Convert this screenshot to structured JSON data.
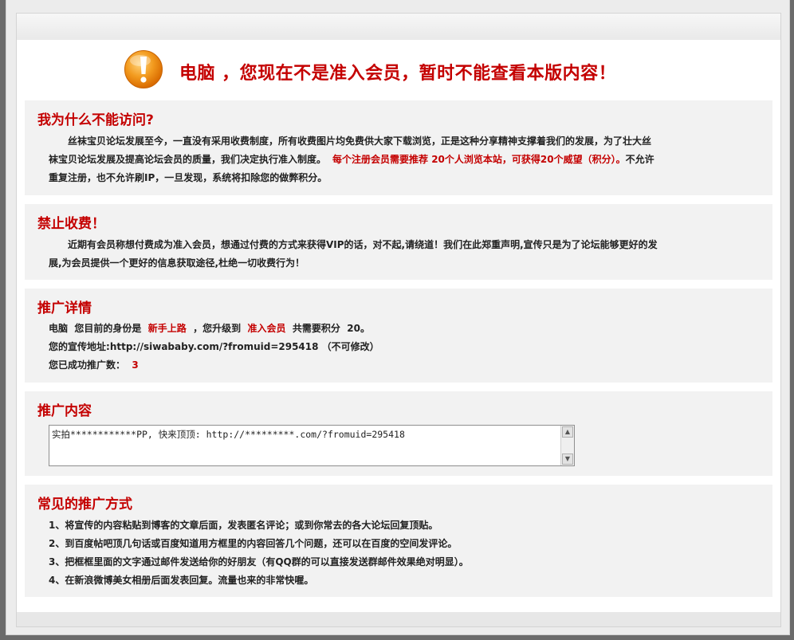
{
  "header": {
    "title": "电脑 ，您现在不是准入会员，暂时不能查看本版内容！"
  },
  "why": {
    "title": "我为什么不能访问?",
    "line1": "丝袜宝贝论坛发展至今，一直没有采用收费制度，所有收费图片均免费供大家下载浏览，正是这种分享精神支撑着我们的发展，为了壮大丝",
    "line2_pre": "袜宝贝论坛发展及提高论坛会员的质量，我们决定执行准入制度。",
    "line2_hl": "每个注册会员需要推荐 20个人浏览本站，可获得20个威望（积分）。",
    "line2_post": "不允许",
    "line3": "重复注册，也不允许刷IP，一旦发现，系统将扣除您的做弊积分。"
  },
  "nofee": {
    "title": "禁止收费！",
    "line1": "近期有会员称想付费成为准入会员，想通过付费的方式来获得VIP的话，对不起,请绕道！我们在此郑重声明,宣传只是为了论坛能够更好的发",
    "line2": "展,为会员提供一个更好的信息获取途径,杜绝一切收费行为！"
  },
  "promo": {
    "title": "推广详情",
    "user": "电脑",
    "identity_label": "您目前的身份是",
    "identity": "新手上路",
    "upgrade_label": "，您升级到",
    "target": "准入会员",
    "points_label": "共需要积分",
    "points": "20",
    "end": "。",
    "url_label": "您的宣传地址:",
    "url": "http://siwababy.com/?fromuid=295418",
    "url_note": "（不可修改）",
    "count_label": "您已成功推广数：",
    "count": "3"
  },
  "content": {
    "title": "推广内容",
    "text": "实拍************PP, 快来顶顶:  http://*********.com/?fromuid=295418"
  },
  "methods": {
    "title": "常见的推广方式",
    "items": [
      "1、将宣传的内容粘贴到博客的文章后面，发表匿名评论；或到你常去的各大论坛回复顶贴。",
      "2、到百度帖吧顶几句话或百度知道用方框里的内容回答几个问题，还可以在百度的空间发评论。",
      "3、把框框里面的文字通过邮件发送给你的好朋友（有QQ群的可以直接发送群邮件效果绝对明显）。",
      "4、在新浪微博美女相册后面发表回复。流量也来的非常快喔。"
    ]
  },
  "colors": {
    "accent": "#c40000",
    "section_bg": "#f2f2f2"
  }
}
